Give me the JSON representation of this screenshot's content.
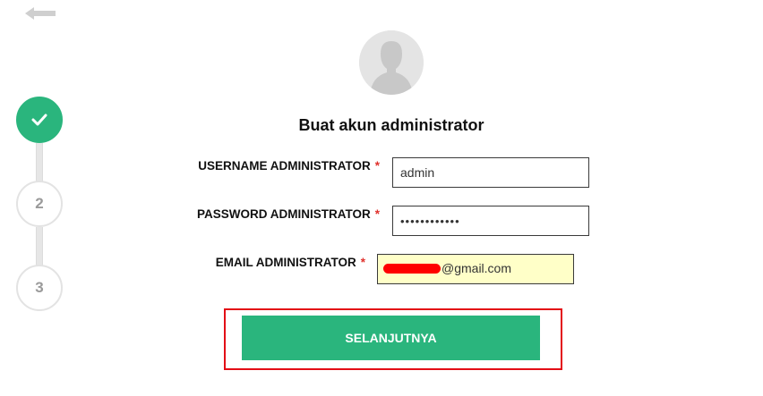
{
  "steps": [
    {
      "label": "",
      "status": "done",
      "icon": "check-icon"
    },
    {
      "label": "2",
      "status": "todo"
    },
    {
      "label": "3",
      "status": "todo"
    }
  ],
  "form": {
    "title": "Buat akun administrator",
    "required_mark": "*",
    "username": {
      "label": "USERNAME ADMINISTRATOR",
      "value": "admin"
    },
    "password": {
      "label": "PASSWORD ADMINISTRATOR",
      "value": "••••••••••••"
    },
    "email": {
      "label": "EMAIL ADMINISTRATOR",
      "value_suffix": "@gmail.com",
      "autofill_color": "#ffffc8"
    },
    "next_label": "SELANJUTNYA"
  },
  "colors": {
    "accent": "#2ab57d",
    "required": "#e0322d",
    "highlight": "#e30d16",
    "redaction": "#ff0000"
  }
}
